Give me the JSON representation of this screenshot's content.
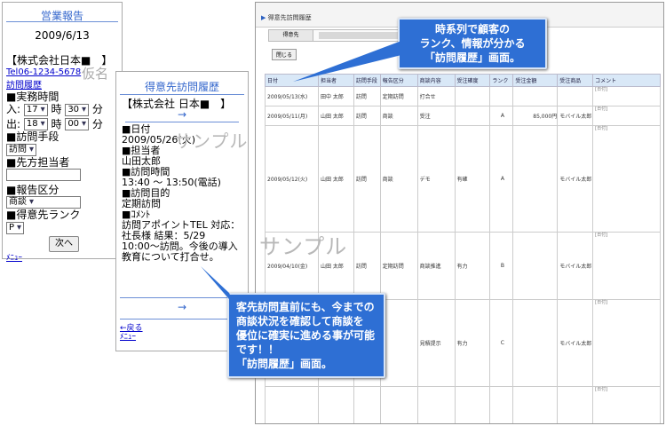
{
  "mobile_report": {
    "title": "営業報告",
    "date": "2009/6/13",
    "company": "【株式会社日本■　】",
    "tel": "Tel06-1234-5678",
    "history_link": "訪問履歴",
    "work_time_label": "■実務時間",
    "in_label": "入:",
    "in_hour": "17",
    "in_min": "30",
    "out_label": "出:",
    "out_hour": "18",
    "out_min": "00",
    "hour_unit": "時",
    "min_unit": "分",
    "visit_method_label": "■訪問手段",
    "visit_method": "訪問",
    "contact_label": "■先方担当者",
    "report_type_label": "■報告区分",
    "report_type": "商談",
    "rank_label": "■得意先ランク",
    "rank": "P",
    "next_button": "次へ",
    "menu_link": "ﾒﾆｭｰ",
    "kana_note": "仮名"
  },
  "mobile_history": {
    "title": "得意先訪問履歴",
    "company": "【株式会社 日本■　】",
    "arrow": "→",
    "date_label": "■日付",
    "date": "2009/05/26(火)",
    "person_label": "■担当者",
    "person": "山田太郎",
    "time_label": "■訪問時間",
    "time": "13:40 ～ 13:50(電話)",
    "purpose_label": "■訪問目的",
    "purpose": "定期訪問",
    "comment_label": "■ｺﾒﾝﾄ",
    "comment": "訪問アポイントTEL 対応：社長様 結果：5/29　10:00～訪問。今後の導入教育について打合せ。",
    "back_link": "←戻る",
    "menu_link": "ﾒﾆｭｰ"
  },
  "watermark": "サンプル",
  "web": {
    "title": "得意先訪問履歴",
    "filter_label": "得意先",
    "close_button": "閉じる",
    "columns": [
      "日付",
      "担当者",
      "訪問手段",
      "報告区分",
      "商談内容",
      "受注確度",
      "ランク",
      "受注金額",
      "受注商品",
      "コメント"
    ],
    "rows": [
      {
        "date": "2009/05/13(水)",
        "person": "田中 太郎",
        "method": "訪問",
        "type": "定期訪問",
        "content": "打合せ",
        "certainty": "",
        "rank": "",
        "amount": "",
        "product": "",
        "comment": "[日付]"
      },
      {
        "date": "2009/05/11(月)",
        "person": "山田 太郎",
        "method": "訪問",
        "type": "商談",
        "content": "受注",
        "certainty": "",
        "rank": "A",
        "amount": "85,000円",
        "product": "モバイル太郎",
        "comment": "[日付]"
      },
      {
        "date": "2009/05/12(火)",
        "person": "山田 太郎",
        "method": "訪問",
        "type": "商談",
        "content": "デモ",
        "certainty": "有確",
        "rank": "A",
        "amount": "",
        "product": "モバイル太郎",
        "comment": "[日付]"
      },
      {
        "date": "2009/04/10(金)",
        "person": "山田 太郎",
        "method": "訪問",
        "type": "定期訪問",
        "content": "商談推進",
        "certainty": "有力",
        "rank": "B",
        "amount": "",
        "product": "モバイル太郎",
        "comment": "[日付]"
      },
      {
        "date": "",
        "person": "",
        "method": "",
        "type": "",
        "content": "見積提示",
        "certainty": "有力",
        "rank": "C",
        "amount": "",
        "product": "モバイル太郎",
        "comment": "[日付]"
      },
      {
        "date": "",
        "person": "",
        "method": "",
        "type": "",
        "content": "",
        "certainty": "",
        "rank": "",
        "amount": "",
        "product": "",
        "comment": "[日付]"
      }
    ]
  },
  "callout_top": {
    "line1": "時系列で顧客の",
    "line2": "ランク、情報が分かる",
    "line3": "「訪問履歴」画面。"
  },
  "callout_bottom": {
    "line1": "客先訪問直前にも、今までの",
    "line2": "商談状況を確認して商談を",
    "line3": "優位に確実に進める事が可能",
    "line4": "です！！",
    "line5": "「訪問履歴」画面。"
  },
  "colors": {
    "accent": "#3366cc",
    "callout": "#2e6fd4",
    "table_header": "#d9e8f7"
  }
}
